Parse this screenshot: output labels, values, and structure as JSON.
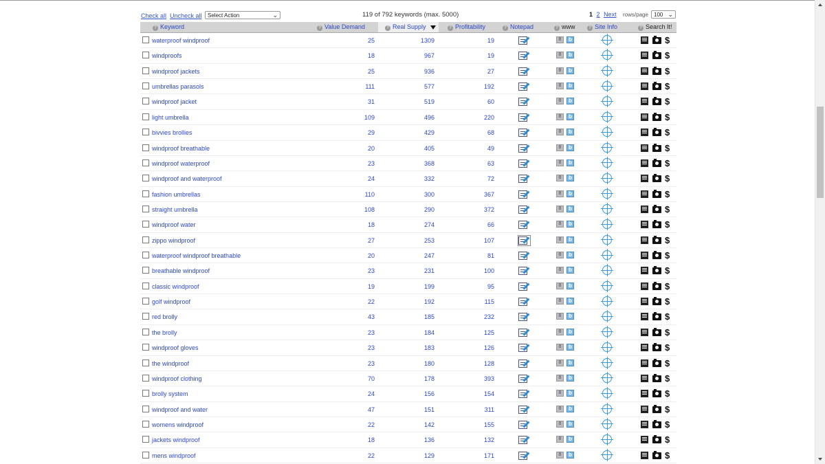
{
  "toolbar": {
    "check_all": "Check all",
    "uncheck_all": "Uncheck all",
    "select_action": "Select Action",
    "keyword_count": "119 of 792 keywords (max. 5000)",
    "page_current": "1",
    "page_2": "2",
    "next": "Next",
    "rows_per_page_label": "rows/page",
    "rows_per_page_value": "100"
  },
  "header": {
    "keyword": "Keyword",
    "value_demand": "Value Demand",
    "real_supply": "Real Supply",
    "profitability": "Profitability",
    "notepad": "Notepad",
    "www": "www",
    "site_info": "Site Info",
    "search_it": "Search It!"
  },
  "icons": {
    "info": "question-icon",
    "sort": "sort-desc-icon",
    "notepad": "notepad-edit-icon",
    "google": "google-icon",
    "bing": "bing-icon",
    "site_info": "compass-icon",
    "doc": "document-icon",
    "camera": "camera-icon",
    "dollar": "dollar-icon"
  },
  "rows": [
    {
      "keyword": "waterproof windproof",
      "vd": "25",
      "rs": "1309",
      "pr": "19"
    },
    {
      "keyword": "windproofs",
      "vd": "18",
      "rs": "967",
      "pr": "19"
    },
    {
      "keyword": "windproof jackets",
      "vd": "25",
      "rs": "936",
      "pr": "27"
    },
    {
      "keyword": "umbrellas parasols",
      "vd": "111",
      "rs": "577",
      "pr": "192"
    },
    {
      "keyword": "windproof jacket",
      "vd": "31",
      "rs": "519",
      "pr": "60"
    },
    {
      "keyword": "light umbrella",
      "vd": "109",
      "rs": "496",
      "pr": "220"
    },
    {
      "keyword": "bivvies brollies",
      "vd": "29",
      "rs": "429",
      "pr": "68"
    },
    {
      "keyword": "windproof breathable",
      "vd": "20",
      "rs": "405",
      "pr": "49"
    },
    {
      "keyword": "windproof waterproof",
      "vd": "23",
      "rs": "368",
      "pr": "63"
    },
    {
      "keyword": "windproof and waterproof",
      "vd": "24",
      "rs": "332",
      "pr": "72"
    },
    {
      "keyword": "fashion umbrellas",
      "vd": "110",
      "rs": "300",
      "pr": "367"
    },
    {
      "keyword": "straight umbrella",
      "vd": "108",
      "rs": "290",
      "pr": "372"
    },
    {
      "keyword": "windproof water",
      "vd": "18",
      "rs": "274",
      "pr": "66"
    },
    {
      "keyword": "zippo windproof",
      "vd": "27",
      "rs": "253",
      "pr": "107"
    },
    {
      "keyword": "waterproof windproof breathable",
      "vd": "20",
      "rs": "247",
      "pr": "81"
    },
    {
      "keyword": "breathable windproof",
      "vd": "23",
      "rs": "231",
      "pr": "100"
    },
    {
      "keyword": "classic windproof",
      "vd": "19",
      "rs": "199",
      "pr": "95"
    },
    {
      "keyword": "golf windproof",
      "vd": "22",
      "rs": "192",
      "pr": "115"
    },
    {
      "keyword": "red brolly",
      "vd": "43",
      "rs": "185",
      "pr": "232"
    },
    {
      "keyword": "the brolly",
      "vd": "23",
      "rs": "184",
      "pr": "125"
    },
    {
      "keyword": "windproof gloves",
      "vd": "23",
      "rs": "183",
      "pr": "126"
    },
    {
      "keyword": "the windproof",
      "vd": "23",
      "rs": "180",
      "pr": "128"
    },
    {
      "keyword": "windproof clothing",
      "vd": "70",
      "rs": "178",
      "pr": "393"
    },
    {
      "keyword": "brolly system",
      "vd": "24",
      "rs": "156",
      "pr": "154"
    },
    {
      "keyword": "windproof and water",
      "vd": "47",
      "rs": "151",
      "pr": "311"
    },
    {
      "keyword": "womens windproof",
      "vd": "22",
      "rs": "142",
      "pr": "155"
    },
    {
      "keyword": "jackets windproof",
      "vd": "18",
      "rs": "136",
      "pr": "132"
    },
    {
      "keyword": "mens windproof",
      "vd": "22",
      "rs": "129",
      "pr": "171"
    }
  ]
}
